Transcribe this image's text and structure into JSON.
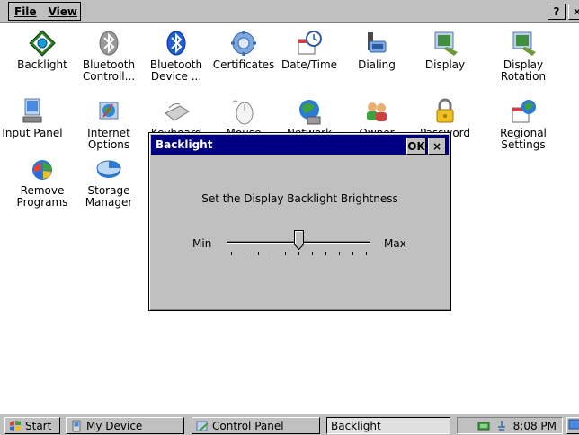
{
  "menubar": {
    "file": "File",
    "view": "View",
    "help": "?",
    "close": "×"
  },
  "icons": [
    {
      "label": "Backlight",
      "icon": "backlight-icon"
    },
    {
      "label": "Bluetooth\nControll...",
      "icon": "bluetooth-control-icon"
    },
    {
      "label": "Bluetooth\nDevice ...",
      "icon": "bluetooth-device-icon"
    },
    {
      "label": "Certificates",
      "icon": "certificates-icon"
    },
    {
      "label": "Date/Time",
      "icon": "datetime-icon"
    },
    {
      "label": "Dialing",
      "icon": "dialing-icon"
    },
    {
      "label": "Display",
      "icon": "display-icon"
    },
    {
      "label": "Display\nRotation",
      "icon": "display-rotation-icon"
    },
    {
      "label": "Input Panel",
      "icon": "input-panel-icon"
    },
    {
      "label": "Internet\nOptions",
      "icon": "internet-options-icon"
    },
    {
      "label": "Keyboard",
      "icon": "keyboard-icon"
    },
    {
      "label": "Mouse",
      "icon": "mouse-icon"
    },
    {
      "label": "Network and",
      "icon": "network-icon"
    },
    {
      "label": "Owner",
      "icon": "owner-icon"
    },
    {
      "label": "Password",
      "icon": "password-icon"
    },
    {
      "label": "Regional\nSettings",
      "icon": "regional-settings-icon"
    },
    {
      "label": "Remove\nPrograms",
      "icon": "remove-programs-icon"
    },
    {
      "label": "Storage\nManager",
      "icon": "storage-manager-icon"
    }
  ],
  "dialog": {
    "title": "Backlight",
    "ok": "OK",
    "close": "×",
    "caption": "Set the Display Backlight Brightness",
    "min_label": "Min",
    "max_label": "Max",
    "slider_value": 0.5,
    "tick_count": 11
  },
  "taskbar": {
    "start": "Start",
    "my_device": "My Device",
    "control_panel": "Control Panel",
    "backlight": "Backlight",
    "time": "8:08 PM"
  },
  "colors": {
    "title_bar": "#000080",
    "chrome": "#c0c0c0"
  }
}
